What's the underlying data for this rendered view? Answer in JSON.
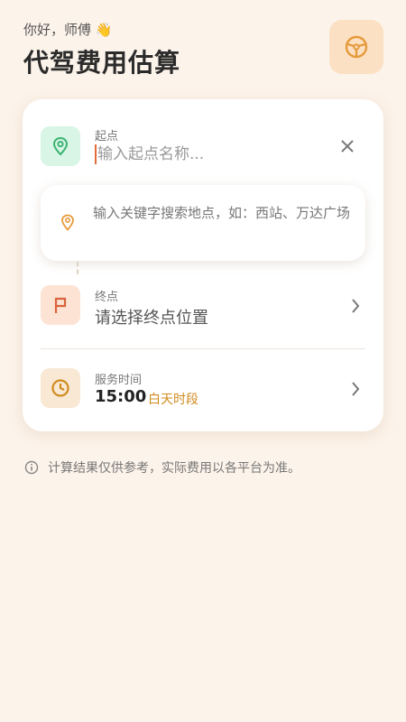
{
  "header": {
    "greeting": "你好，师傅 👋",
    "title": "代驾费用估算",
    "wheel_icon": "steering-wheel-icon"
  },
  "start": {
    "label": "起点",
    "placeholder": "输入起点名称...",
    "icon": "location-pin-icon",
    "clear_icon": "close-icon"
  },
  "suggestion": {
    "text": "输入关键字搜索地点，如：西站、万达广场",
    "icon": "location-pin-icon"
  },
  "end": {
    "label": "终点",
    "value": "请选择终点位置",
    "icon": "flag-icon"
  },
  "service_time": {
    "label": "服务时间",
    "time": "15:00",
    "period": "白天时段",
    "icon": "clock-icon"
  },
  "note": {
    "text": "计算结果仅供参考，实际费用以各平台为准。",
    "icon": "info-icon"
  },
  "colors": {
    "background": "#fcf3ea",
    "accent_orange": "#e69a3b",
    "start_green": "#3cb371",
    "end_red": "#d9633d",
    "period_orange": "#d18a1e"
  }
}
